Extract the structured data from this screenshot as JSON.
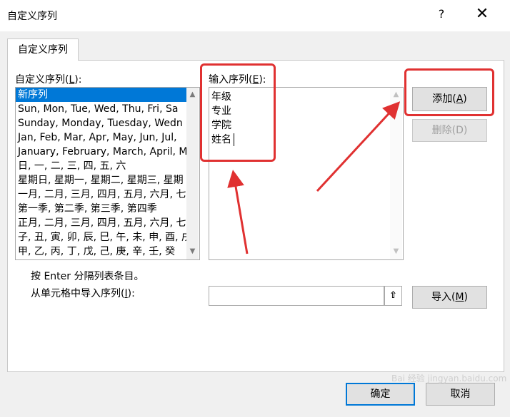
{
  "window": {
    "title": "自定义序列",
    "help_symbol": "?",
    "close_symbol": "✕"
  },
  "tab": {
    "label": "自定义序列"
  },
  "custom_lists": {
    "label_prefix": "自定义序列(",
    "label_key": "L",
    "label_suffix": "):",
    "items": [
      "新序列",
      "Sun, Mon, Tue, Wed, Thu, Fri, Sa",
      "Sunday, Monday, Tuesday, Wedn",
      "Jan, Feb, Mar, Apr, May, Jun, Jul,",
      "January, February, March, April, M",
      "日, 一, 二, 三, 四, 五, 六",
      "星期日, 星期一, 星期二, 星期三, 星期",
      "一月, 二月, 三月, 四月, 五月, 六月, 七",
      "第一季, 第二季, 第三季, 第四季",
      "正月, 二月, 三月, 四月, 五月, 六月, 七",
      "子, 丑, 寅, 卯, 辰, 巳, 午, 未, 申, 酉, 戌",
      "甲, 乙, 丙, 丁, 戊, 己, 庚, 辛, 壬, 癸"
    ]
  },
  "entries": {
    "label_prefix": "输入序列(",
    "label_key": "E",
    "label_suffix": "):",
    "items": [
      "年级",
      "专业",
      "学院",
      "姓名"
    ]
  },
  "buttons": {
    "add_prefix": "添加(",
    "add_key": "A",
    "add_suffix": ")",
    "delete": "删除(D)",
    "import_prefix": "导入(",
    "import_key": "M",
    "import_suffix": ")",
    "ok": "确定",
    "cancel": "取消"
  },
  "hint": "按 Enter 分隔列表条目。",
  "import": {
    "label_prefix": "从单元格中导入序列(",
    "label_key": "I",
    "label_suffix": "):",
    "value": "",
    "range_icon": "⇧"
  },
  "watermark": "Bai 经验 jingyan.baidu.com",
  "colors": {
    "selection": "#0078d7",
    "annotation": "#e03131",
    "ok_border": "#0078d7"
  }
}
